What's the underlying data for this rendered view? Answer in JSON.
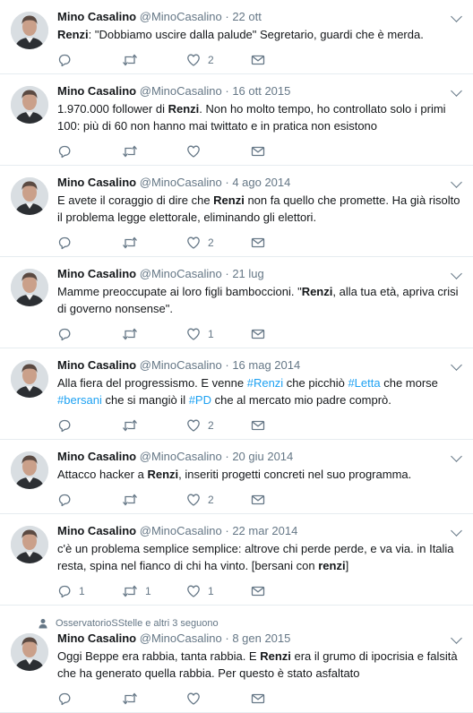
{
  "tweets": [
    {
      "name": "Mino Casalino",
      "handle": "@MinoCasalino",
      "date": "22 ott",
      "segments": [
        {
          "text": "Renzi",
          "bold": true
        },
        {
          "text": ": \"Dobbiamo uscire dalla palude\"  Segretario, guardi che è merda."
        }
      ],
      "replies": "",
      "retweets": "",
      "likes": "2"
    },
    {
      "name": "Mino Casalino",
      "handle": "@MinoCasalino",
      "date": "16 ott 2015",
      "segments": [
        {
          "text": "1.970.000 follower di "
        },
        {
          "text": "Renzi",
          "bold": true
        },
        {
          "text": ". Non ho molto tempo, ho controllato solo i primi 100: più di 60 non hanno mai twittato e in pratica non esistono"
        }
      ],
      "replies": "",
      "retweets": "",
      "likes": ""
    },
    {
      "name": "Mino Casalino",
      "handle": "@MinoCasalino",
      "date": "4 ago 2014",
      "segments": [
        {
          "text": "E avete il coraggio di dire che "
        },
        {
          "text": "Renzi",
          "bold": true
        },
        {
          "text": " non fa quello che promette. Ha già risolto il problema legge elettorale, eliminando gli elettori."
        }
      ],
      "replies": "",
      "retweets": "",
      "likes": "2"
    },
    {
      "name": "Mino Casalino",
      "handle": "@MinoCasalino",
      "date": "21 lug",
      "segments": [
        {
          "text": "Mamme preoccupate ai loro figli bamboccioni. \""
        },
        {
          "text": "Renzi",
          "bold": true
        },
        {
          "text": ", alla tua età, apriva crisi di governo nonsense\"."
        }
      ],
      "replies": "",
      "retweets": "",
      "likes": "1"
    },
    {
      "name": "Mino Casalino",
      "handle": "@MinoCasalino",
      "date": "16 mag 2014",
      "segments": [
        {
          "text": "Alla fiera del progressismo.  E venne "
        },
        {
          "text": "#Renzi",
          "hashtag": true
        },
        {
          "text": "  che picchiò "
        },
        {
          "text": "#Letta",
          "hashtag": true
        },
        {
          "text": " che morse "
        },
        {
          "text": "#bersani",
          "hashtag": true
        },
        {
          "text": "  che si mangiò il "
        },
        {
          "text": "#PD",
          "hashtag": true
        },
        {
          "text": "  che al mercato mio padre comprò."
        }
      ],
      "replies": "",
      "retweets": "",
      "likes": "2"
    },
    {
      "name": "Mino Casalino",
      "handle": "@MinoCasalino",
      "date": "20 giu 2014",
      "segments": [
        {
          "text": "Attacco hacker a "
        },
        {
          "text": "Renzi",
          "bold": true
        },
        {
          "text": ", inseriti progetti concreti nel suo programma."
        }
      ],
      "replies": "",
      "retweets": "",
      "likes": "2"
    },
    {
      "name": "Mino Casalino",
      "handle": "@MinoCasalino",
      "date": "22 mar 2014",
      "segments": [
        {
          "text": "c'è un problema semplice semplice: altrove chi perde perde, e va via. in Italia resta, spina nel fianco di chi ha vinto. [bersani con "
        },
        {
          "text": "renzi",
          "bold": true
        },
        {
          "text": "]"
        }
      ],
      "replies": "1",
      "retweets": "1",
      "likes": "1"
    },
    {
      "context": "OsservatorioSStelle e altri 3 seguono",
      "name": "Mino Casalino",
      "handle": "@MinoCasalino",
      "date": "8 gen 2015",
      "segments": [
        {
          "text": "Oggi Beppe era rabbia, tanta rabbia. E "
        },
        {
          "text": "Renzi",
          "bold": true
        },
        {
          "text": " era il grumo di ipocrisia e falsità che ha generato quella rabbia. Per questo è stato asfaltato"
        }
      ],
      "replies": "",
      "retweets": "",
      "likes": ""
    }
  ],
  "separator": "·",
  "icons": {
    "reply": "reply-icon",
    "retweet": "retweet-icon",
    "like": "heart-icon",
    "dm": "envelope-icon",
    "caret": "chevron-down-icon",
    "context": "person-icon"
  },
  "colors": {
    "text": "#14171a",
    "secondary": "#657786",
    "hashtag": "#1da1f2",
    "divider": "#e6ecf0"
  }
}
